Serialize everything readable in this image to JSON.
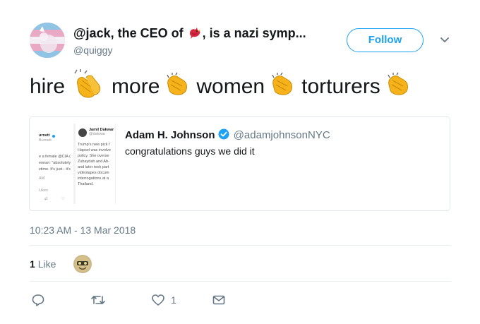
{
  "tweet": {
    "display_name_part1": "@jack, the CEO of",
    "display_name_part2": ", is a nazi symp...",
    "handle": "@quiggy",
    "follow_label": "Follow",
    "text_words": [
      "hire",
      "more",
      "women",
      "torturers"
    ],
    "timestamp": "10:23 AM - 13 Mar 2018",
    "likes_count": "1",
    "likes_label": "Like"
  },
  "quoted": {
    "name": "Adam H. Johnson",
    "handle": "@adamjohnsonNYC",
    "text": "congratulations guys we did it",
    "image": {
      "left_col": [
        "urnett",
        "Burnett",
        "e a female @CIA (",
        "ennan: \"absolutely",
        "ztime. It's just-- it's",
        "AM",
        "Likes"
      ],
      "right_name": "Jamil Dakwar",
      "right_handle": "@dakwar",
      "right_lines": [
        "Trump's new pick f",
        "Hapsel was involve",
        "policy. She overse",
        "Zubaydah and Ab-",
        "and later took part",
        "videotapes docum",
        "interrogations at a",
        "Thailand."
      ]
    }
  },
  "actions": {
    "reply": "",
    "retweet": "",
    "like_count": "1",
    "dm": ""
  },
  "icons": [
    "red-bird-emoji",
    "clapping-hands-emoji",
    "chevron-down-icon",
    "verified-icon",
    "reply-icon",
    "retweet-icon",
    "heart-icon",
    "envelope-icon"
  ],
  "colors": {
    "accent": "#1da1f2",
    "muted": "#657786",
    "border": "#e1e8ed",
    "clap": "#f5b21b"
  }
}
